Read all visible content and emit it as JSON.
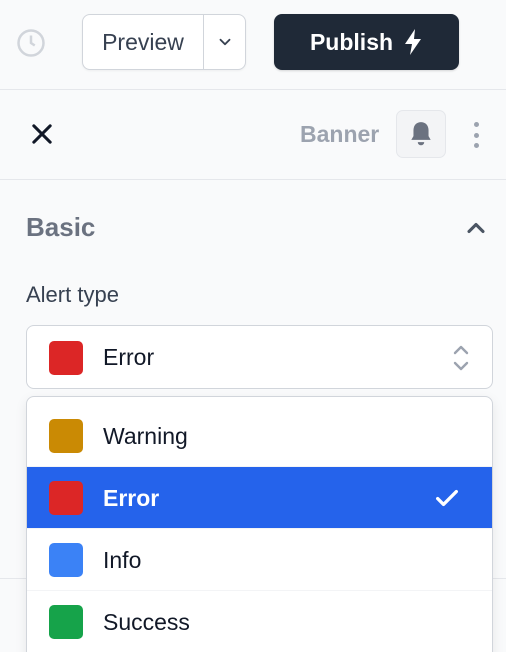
{
  "toolbar": {
    "preview_label": "Preview",
    "publish_label": "Publish"
  },
  "panel": {
    "title": "Banner"
  },
  "section": {
    "title": "Basic"
  },
  "field": {
    "label": "Alert type",
    "selected": {
      "label": "Error",
      "color": "#dc2626"
    }
  },
  "options": [
    {
      "label": "Warning",
      "color": "#ca8a04",
      "selected": false
    },
    {
      "label": "Error",
      "color": "#dc2626",
      "selected": true
    },
    {
      "label": "Info",
      "color": "#3b82f6",
      "selected": false
    },
    {
      "label": "Success",
      "color": "#16a34a",
      "selected": false
    }
  ],
  "colors": {
    "accent": "#2563eb",
    "publish_bg": "#1f2937"
  }
}
